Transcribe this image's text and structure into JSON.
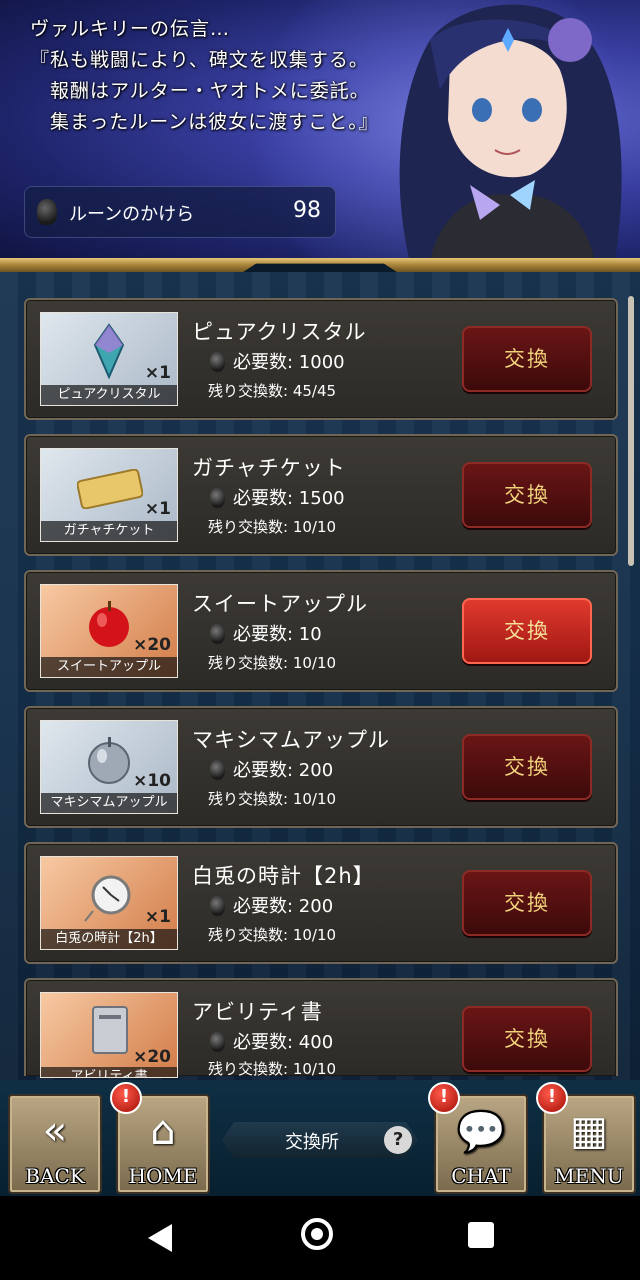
{
  "header": {
    "message": "ヴァルキリーの伝言…\n『私も戦闘により、碑文を収集する。\n　報酬はアルター・ヤオトメに委託。\n　集まったルーンは彼女に渡すこと。』",
    "rune_label": "ルーンのかけら",
    "rune_count": "98"
  },
  "items": [
    {
      "title": "ピュアクリスタル",
      "caption": "ピュアクリスタル",
      "qty": "×1",
      "required": "必要数: 1000",
      "remaining": "残り交換数: 45/45",
      "button": "交換",
      "theme": "blue",
      "icon": "crystal-icon"
    },
    {
      "title": "ガチャチケット",
      "caption": "ガチャチケット",
      "qty": "×1",
      "required": "必要数: 1500",
      "remaining": "残り交換数: 10/10",
      "button": "交換",
      "theme": "blue",
      "icon": "gacha-ticket-icon"
    },
    {
      "title": "スイートアップル",
      "caption": "スイートアップル",
      "qty": "×20",
      "required": "必要数: 10",
      "remaining": "残り交換数: 10/10",
      "button": "交換",
      "theme": "orange",
      "icon": "red-apple-icon"
    },
    {
      "title": "マキシマムアップル",
      "caption": "マキシマムアップル",
      "qty": "×10",
      "required": "必要数: 200",
      "remaining": "残り交換数: 10/10",
      "button": "交換",
      "theme": "blue",
      "icon": "silver-apple-icon"
    },
    {
      "title": "白兎の時計【2h】",
      "caption": "白兎の時計【2h】",
      "qty": "×1",
      "required": "必要数: 200",
      "remaining": "残り交換数: 10/10",
      "button": "交換",
      "theme": "orange",
      "icon": "pocket-watch-icon"
    },
    {
      "title": "アビリティ書",
      "caption": "アビリティ書",
      "qty": "×20",
      "required": "必要数: 400",
      "remaining": "残り交換数: 10/10",
      "button": "交換",
      "theme": "orange",
      "icon": "ability-book-icon"
    }
  ],
  "nav": {
    "back": "BACK",
    "home": "HOME",
    "center": "交換所",
    "help": "?",
    "chat": "CHAT",
    "menu": "MENU",
    "alert": "!"
  },
  "colors": {
    "button_active": "#d22a20",
    "button_idle": "#5a1010",
    "button_text": "#f0d27b"
  }
}
